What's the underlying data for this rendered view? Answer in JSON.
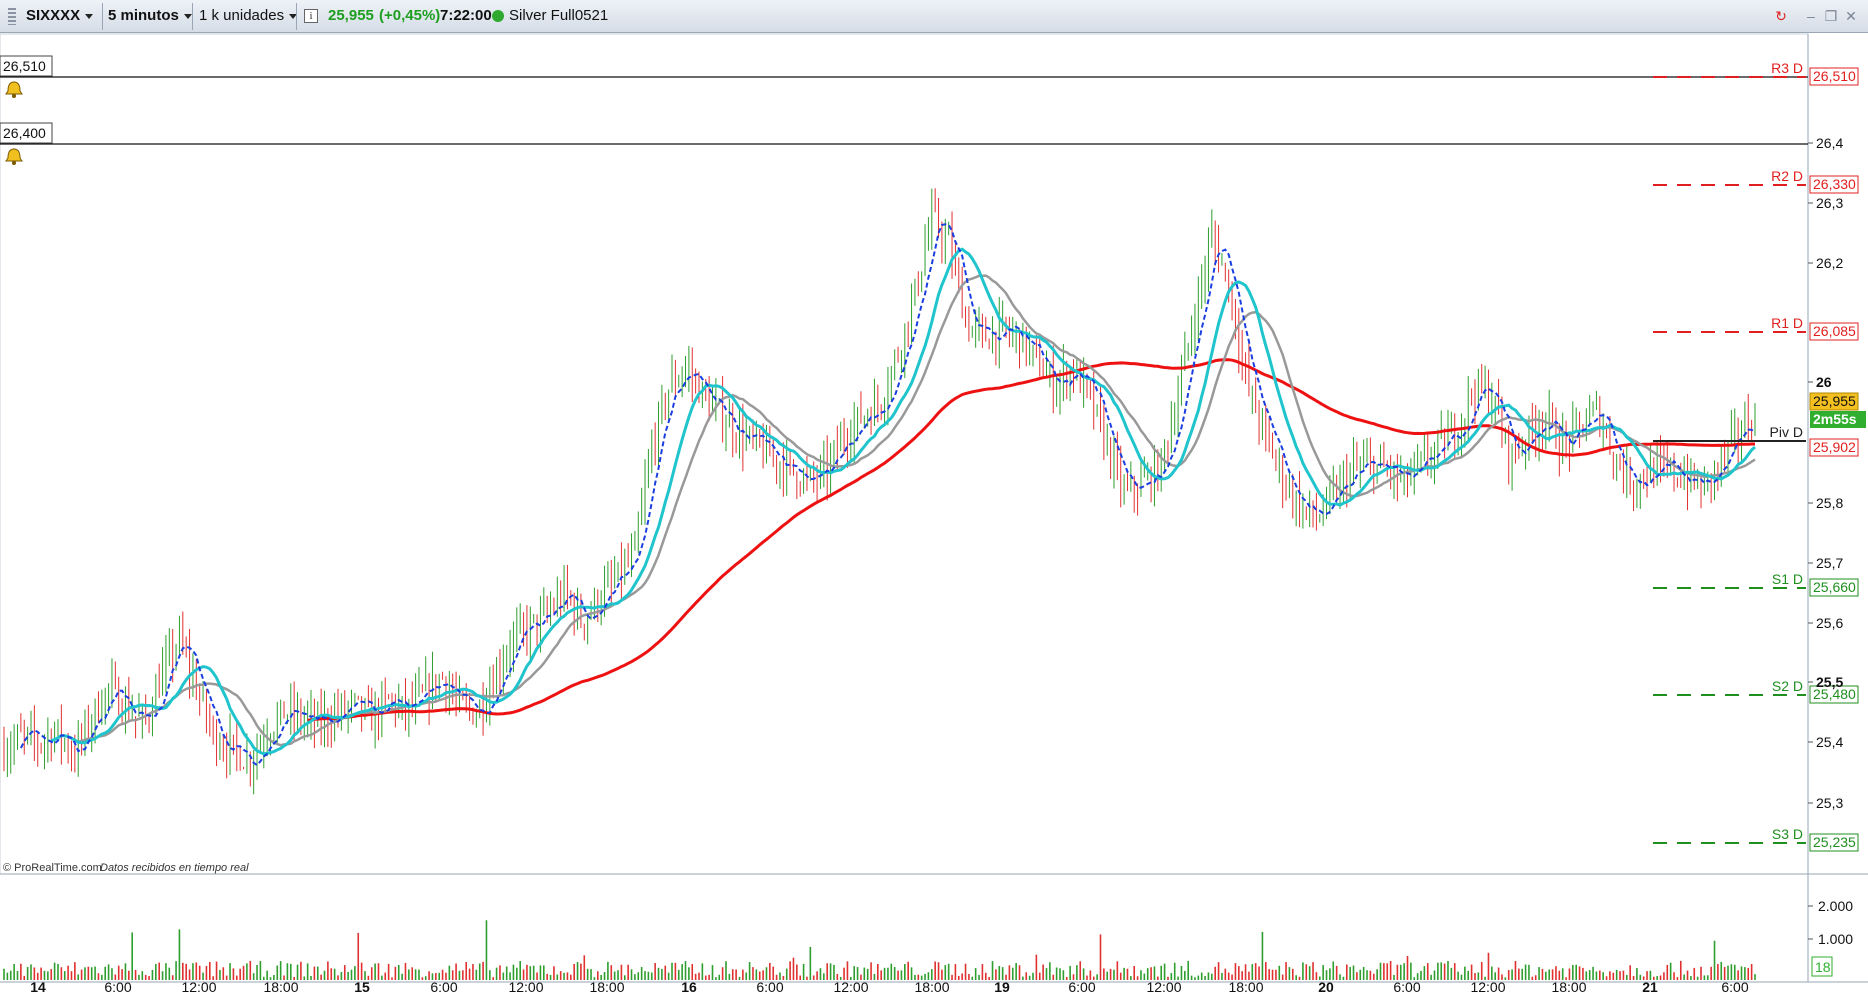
{
  "toolbar": {
    "symbol": "SIXXXX",
    "timeframe": "5 minutos",
    "units": "1 k unidades",
    "price": "25,955",
    "change": "(+0,45%)",
    "time": "7:22:00",
    "instrument": "Silver Full0521",
    "icons": [
      "grip-icon",
      "info-icon",
      "connection-status-icon",
      "refresh-icon",
      "minimize-icon",
      "restore-icon",
      "close-icon"
    ]
  },
  "alerts": [
    {
      "label": "26,510",
      "icon": "bell-icon"
    },
    {
      "label": "26,400",
      "icon": "bell-icon"
    }
  ],
  "pivots": [
    {
      "name": "R3 D",
      "value": "26,510",
      "color": "#e02020"
    },
    {
      "name": "R2 D",
      "value": "26,330",
      "color": "#e02020"
    },
    {
      "name": "R1 D",
      "value": "26,085",
      "color": "#e02020"
    },
    {
      "name": "Piv D",
      "value": "25,902",
      "color": "#222222"
    },
    {
      "name": "S1 D",
      "value": "25,660",
      "color": "#1f8f1f"
    },
    {
      "name": "S2 D",
      "value": "25,480",
      "color": "#1f8f1f"
    },
    {
      "name": "S3 D",
      "value": "25,235",
      "color": "#1f8f1f"
    }
  ],
  "price_axis_labels": [
    "26,4",
    "26,3",
    "26,2",
    "26",
    "25,8",
    "25,7",
    "25,6",
    "25,5",
    "25,4",
    "25,3"
  ],
  "price_tags": {
    "last_price": "25,955",
    "countdown": "2m55s",
    "pivot": "25,902"
  },
  "volume_axis_labels": [
    "2.000",
    "1.000"
  ],
  "volume_tag": "18",
  "time_axis_labels": [
    {
      "label": "14",
      "bold": true
    },
    {
      "label": "6:00"
    },
    {
      "label": "12:00"
    },
    {
      "label": "18:00"
    },
    {
      "label": "15",
      "bold": true
    },
    {
      "label": "6:00"
    },
    {
      "label": "12:00"
    },
    {
      "label": "18:00"
    },
    {
      "label": "16",
      "bold": true
    },
    {
      "label": "6:00"
    },
    {
      "label": "12:00"
    },
    {
      "label": "18:00"
    },
    {
      "label": "19",
      "bold": true
    },
    {
      "label": "6:00"
    },
    {
      "label": "12:00"
    },
    {
      "label": "18:00"
    },
    {
      "label": "20",
      "bold": true
    },
    {
      "label": "6:00"
    },
    {
      "label": "12:00"
    },
    {
      "label": "18:00"
    },
    {
      "label": "21",
      "bold": true
    },
    {
      "label": "6:00"
    }
  ],
  "footer": {
    "brand": "© ProRealTime.com",
    "note": "Datos recibidos en tiempo real"
  },
  "colors": {
    "up": "#2e9e2e",
    "down": "#e03030",
    "ma_red": "#ee1111",
    "ma_cyan": "#1fc4cc",
    "ma_gray": "#999999",
    "ma_blue": "#1a3ee0"
  },
  "chart_data": {
    "type": "line",
    "price_range": [
      25.2,
      26.55
    ],
    "price_series_close": [
      25.4,
      25.42,
      25.41,
      25.43,
      25.39,
      25.45,
      25.5,
      25.47,
      25.44,
      25.52,
      25.58,
      25.5,
      25.42,
      25.4,
      25.38,
      25.43,
      25.46,
      25.45,
      25.44,
      25.46,
      25.47,
      25.45,
      25.48,
      25.46,
      25.49,
      25.52,
      25.47,
      25.46,
      25.52,
      25.58,
      25.6,
      25.62,
      25.66,
      25.61,
      25.65,
      25.68,
      25.72,
      25.9,
      26.0,
      26.03,
      25.98,
      25.95,
      25.92,
      25.9,
      25.88,
      25.86,
      25.84,
      25.86,
      25.92,
      25.95,
      25.97,
      26.05,
      26.15,
      26.28,
      26.23,
      26.1,
      26.08,
      26.09,
      26.08,
      26.04,
      26.0,
      26.03,
      25.98,
      25.9,
      25.82,
      25.84,
      25.86,
      25.98,
      26.12,
      26.25,
      26.16,
      26.0,
      25.92,
      25.85,
      25.8,
      25.78,
      25.82,
      25.86,
      25.87,
      25.86,
      25.84,
      25.87,
      25.9,
      25.93,
      26.0,
      25.98,
      25.88,
      25.92,
      25.95,
      25.9,
      25.93,
      25.96,
      25.88,
      25.84,
      25.86,
      25.86,
      25.85,
      25.83,
      25.87,
      25.92,
      25.95
    ],
    "volume_axis": {
      "ticks": [
        1000,
        2000
      ]
    }
  }
}
